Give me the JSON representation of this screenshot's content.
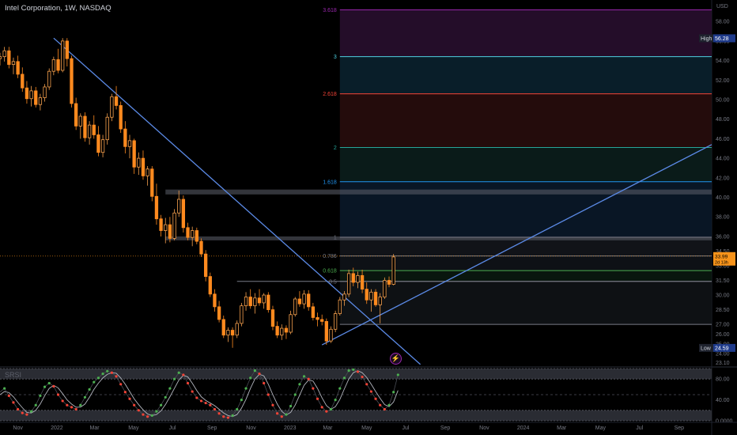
{
  "header": {
    "symbol_line": "Intel Corporation, 1W, NASDAQ",
    "indicator_title": "SRSI"
  },
  "chart_data": {
    "type": "candlestick",
    "price_axis": {
      "unit_label": "USD",
      "ticks": [
        "58.00",
        "56.00",
        "54.00",
        "52.00",
        "50.00",
        "48.00",
        "46.00",
        "44.00",
        "42.00",
        "40.00",
        "38.00",
        "36.00",
        "34.50",
        "33.00",
        "31.50",
        "30.00",
        "28.50",
        "27.00",
        "26.00",
        "25.00",
        "24.00",
        "23.10"
      ],
      "tick_values": [
        58,
        56,
        54,
        52,
        50,
        48,
        46,
        44,
        42,
        40,
        38,
        36,
        34.5,
        33,
        31.5,
        30,
        28.5,
        27,
        26,
        25,
        24,
        23.1
      ],
      "range": [
        22.8,
        60.2
      ]
    },
    "time_axis": {
      "labels": [
        "Nov",
        "2022",
        "Mar",
        "May",
        "Jul",
        "Sep",
        "Nov",
        "2023",
        "Mar",
        "May",
        "Jul",
        "Sep",
        "Nov",
        "2024",
        "Mar",
        "May",
        "Jul",
        "Sep"
      ],
      "dates": [
        "2021-11-01",
        "2022-01-01",
        "2022-03-01",
        "2022-05-01",
        "2022-07-01",
        "2022-09-01",
        "2022-11-01",
        "2023-01-01",
        "2023-03-01",
        "2023-05-01",
        "2023-07-01",
        "2023-09-01",
        "2023-11-01",
        "2024-01-01",
        "2024-03-01",
        "2024-05-01",
        "2024-07-01",
        "2024-09-01"
      ],
      "range": [
        "2021-10-04",
        "2024-10-22"
      ],
      "first_candle_date": "2021-10-04"
    },
    "candles": [
      [
        54.2,
        54.8,
        53.5,
        54.4
      ],
      [
        54.4,
        55.4,
        53.9,
        55.0
      ],
      [
        55.0,
        55.4,
        53.2,
        53.6
      ],
      [
        53.6,
        54.3,
        52.6,
        53.9
      ],
      [
        53.9,
        54.5,
        52.2,
        52.6
      ],
      [
        52.6,
        53.3,
        50.8,
        51.2
      ],
      [
        51.2,
        51.9,
        49.6,
        50.1
      ],
      [
        50.1,
        51.4,
        49.3,
        50.9
      ],
      [
        50.9,
        51.3,
        49.2,
        49.5
      ],
      [
        49.5,
        50.6,
        48.9,
        50.2
      ],
      [
        50.2,
        51.6,
        49.8,
        51.3
      ],
      [
        51.3,
        53.2,
        51.0,
        52.9
      ],
      [
        52.9,
        54.4,
        52.5,
        54.1
      ],
      [
        54.1,
        55.2,
        52.7,
        53.0
      ],
      [
        53.0,
        56.3,
        52.8,
        56.0
      ],
      [
        56.0,
        56.3,
        53.4,
        54.2
      ],
      [
        54.2,
        54.5,
        49.2,
        49.6
      ],
      [
        49.6,
        50.2,
        46.9,
        47.3
      ],
      [
        47.3,
        48.6,
        46.0,
        48.3
      ],
      [
        48.3,
        48.7,
        45.7,
        46.1
      ],
      [
        46.1,
        47.8,
        45.4,
        47.4
      ],
      [
        47.4,
        48.4,
        46.0,
        46.4
      ],
      [
        46.4,
        47.3,
        44.2,
        44.6
      ],
      [
        44.6,
        46.4,
        44.1,
        45.9
      ],
      [
        45.9,
        48.6,
        45.4,
        48.2
      ],
      [
        48.2,
        50.6,
        47.8,
        50.3
      ],
      [
        50.3,
        51.4,
        49.0,
        49.4
      ],
      [
        49.4,
        49.8,
        46.6,
        47.0
      ],
      [
        47.0,
        47.8,
        44.5,
        45.2
      ],
      [
        45.2,
        46.4,
        44.0,
        45.8
      ],
      [
        45.8,
        46.0,
        42.4,
        43.1
      ],
      [
        43.1,
        44.6,
        42.3,
        44.0
      ],
      [
        44.0,
        44.8,
        41.8,
        42.2
      ],
      [
        42.2,
        43.2,
        41.2,
        42.9
      ],
      [
        42.9,
        43.2,
        39.6,
        40.1
      ],
      [
        40.1,
        41.4,
        37.2,
        37.8
      ],
      [
        37.8,
        38.2,
        36.0,
        36.6
      ],
      [
        36.6,
        37.9,
        35.3,
        37.2
      ],
      [
        37.2,
        38.0,
        35.4,
        35.8
      ],
      [
        35.8,
        38.8,
        35.6,
        38.4
      ],
      [
        38.4,
        40.7,
        38.0,
        39.8
      ],
      [
        39.8,
        40.2,
        36.4,
        36.9
      ],
      [
        36.9,
        37.4,
        35.6,
        35.9
      ],
      [
        35.9,
        37.0,
        35.0,
        36.6
      ],
      [
        36.6,
        36.9,
        35.2,
        35.5
      ],
      [
        35.5,
        35.8,
        33.9,
        34.2
      ],
      [
        34.2,
        34.6,
        31.4,
        31.9
      ],
      [
        31.9,
        32.3,
        29.8,
        30.1
      ],
      [
        30.1,
        30.6,
        28.3,
        28.8
      ],
      [
        28.8,
        29.4,
        27.2,
        27.5
      ],
      [
        27.5,
        27.9,
        25.6,
        25.9
      ],
      [
        25.9,
        26.7,
        25.2,
        26.4
      ],
      [
        26.4,
        26.7,
        24.6,
        25.9
      ],
      [
        25.9,
        27.4,
        25.6,
        27.1
      ],
      [
        27.1,
        29.2,
        26.8,
        28.9
      ],
      [
        28.9,
        30.3,
        28.4,
        29.8
      ],
      [
        29.8,
        30.6,
        28.6,
        28.9
      ],
      [
        28.9,
        30.2,
        28.1,
        29.7
      ],
      [
        29.7,
        30.6,
        28.9,
        29.2
      ],
      [
        29.2,
        30.2,
        28.6,
        30.0
      ],
      [
        30.0,
        30.3,
        28.2,
        28.5
      ],
      [
        28.5,
        28.9,
        26.4,
        26.8
      ],
      [
        26.8,
        27.3,
        25.6,
        25.9
      ],
      [
        25.9,
        27.0,
        25.4,
        26.6
      ],
      [
        26.6,
        26.9,
        25.5,
        26.2
      ],
      [
        26.2,
        28.4,
        26.0,
        28.0
      ],
      [
        28.0,
        29.8,
        27.8,
        29.6
      ],
      [
        29.6,
        30.4,
        28.8,
        29.1
      ],
      [
        29.1,
        30.5,
        28.6,
        30.1
      ],
      [
        30.1,
        30.5,
        28.4,
        28.8
      ],
      [
        28.8,
        29.2,
        27.4,
        27.7
      ],
      [
        27.7,
        28.2,
        26.8,
        27.5
      ],
      [
        27.5,
        28.0,
        26.9,
        27.3
      ],
      [
        27.3,
        27.6,
        24.9,
        25.3
      ],
      [
        25.3,
        26.8,
        25.1,
        26.5
      ],
      [
        26.5,
        28.4,
        26.2,
        28.1
      ],
      [
        28.1,
        29.8,
        27.9,
        29.5
      ],
      [
        29.5,
        30.4,
        28.9,
        30.1
      ],
      [
        30.1,
        32.6,
        29.8,
        32.2
      ],
      [
        32.2,
        32.8,
        30.9,
        31.3
      ],
      [
        31.3,
        32.4,
        30.7,
        32.0
      ],
      [
        32.0,
        32.6,
        30.2,
        30.6
      ],
      [
        30.6,
        31.3,
        29.1,
        29.5
      ],
      [
        29.5,
        30.6,
        28.3,
        30.3
      ],
      [
        30.3,
        30.6,
        28.8,
        29.0
      ],
      [
        29.0,
        30.2,
        27.1,
        29.8
      ],
      [
        29.8,
        31.8,
        29.6,
        31.5
      ],
      [
        31.5,
        31.9,
        30.8,
        31.1
      ],
      [
        31.1,
        34.2,
        31.0,
        33.9
      ]
    ],
    "trendlines": [
      {
        "from": [
          "2021-12-27",
          56.3
        ],
        "to": [
          "2023-07-24",
          22.9
        ]
      },
      {
        "from": [
          "2023-02-20",
          24.9
        ],
        "to": [
          "2024-10-22",
          45.4
        ]
      }
    ],
    "horizontal_zones": [
      {
        "low": 40.3,
        "high": 40.8
      },
      {
        "low": 35.6,
        "high": 36.0
      }
    ],
    "fibonacci": {
      "start_date": "2023-03-20",
      "levels": [
        {
          "label": "3.618",
          "value": 59.2,
          "color": "#9c27b0"
        },
        {
          "label": "3",
          "value": 54.4,
          "color": "#4dd0e1"
        },
        {
          "label": "2.618",
          "value": 50.6,
          "color": "#f44336"
        },
        {
          "label": "2",
          "value": 45.1,
          "color": "#26a69a"
        },
        {
          "label": "1.618",
          "value": 41.6,
          "color": "#2196f3"
        },
        {
          "label": "1",
          "value": 35.9,
          "color": "#787b86"
        },
        {
          "label": "0.786",
          "value": 34.0,
          "color": "#787b86"
        },
        {
          "label": "0.618",
          "value": 32.5,
          "color": "#4caf50"
        },
        {
          "label": "0.5",
          "value": 31.4,
          "color": "#787b86"
        },
        {
          "label": "0",
          "value": 27.0,
          "color": "#787b86"
        }
      ]
    },
    "extra_level": {
      "value": 31.4,
      "from_date": "2022-10-10"
    },
    "badges": {
      "high": {
        "label": "High",
        "value": "56.28"
      },
      "low": {
        "label": "Low",
        "value": "24.59"
      },
      "last": {
        "value": "33.99",
        "countdown": "2d 13h"
      }
    },
    "srsi": {
      "axis_ticks": [
        "80.00",
        "40.00",
        "0.0000"
      ],
      "axis_values": [
        80,
        40,
        0
      ],
      "upper_band": [
        80,
        100
      ],
      "lower_band": [
        0,
        20
      ],
      "mid_line": 50,
      "k": [
        55,
        62,
        48,
        35,
        22,
        15,
        12,
        18,
        30,
        48,
        65,
        72,
        66,
        50,
        38,
        30,
        26,
        22,
        30,
        45,
        60,
        74,
        82,
        90,
        95,
        92,
        85,
        70,
        55,
        42,
        30,
        20,
        12,
        8,
        10,
        18,
        30,
        45,
        62,
        80,
        92,
        88,
        72,
        56,
        44,
        38,
        34,
        30,
        22,
        14,
        8,
        6,
        10,
        22,
        40,
        62,
        82,
        96,
        90,
        72,
        50,
        30,
        14,
        8,
        12,
        28,
        50,
        70,
        85,
        80,
        62,
        42,
        26,
        18,
        22,
        40,
        62,
        82,
        96,
        98,
        94,
        84,
        70,
        56,
        42,
        30,
        22,
        30,
        55,
        88
      ],
      "d": [
        50,
        56,
        54,
        46,
        35,
        25,
        16,
        15,
        20,
        32,
        48,
        62,
        68,
        63,
        52,
        40,
        32,
        26,
        26,
        32,
        45,
        60,
        72,
        82,
        89,
        92,
        91,
        82,
        70,
        56,
        42,
        31,
        21,
        13,
        10,
        12,
        19,
        31,
        46,
        62,
        78,
        87,
        84,
        72,
        58,
        46,
        39,
        34,
        29,
        22,
        15,
        10,
        8,
        12,
        24,
        41,
        62,
        80,
        89,
        86,
        70,
        50,
        32,
        18,
        11,
        16,
        30,
        49,
        68,
        78,
        76,
        62,
        44,
        29,
        22,
        27,
        41,
        61,
        80,
        92,
        96,
        92,
        83,
        70,
        56,
        43,
        31,
        27,
        36,
        58
      ]
    }
  }
}
